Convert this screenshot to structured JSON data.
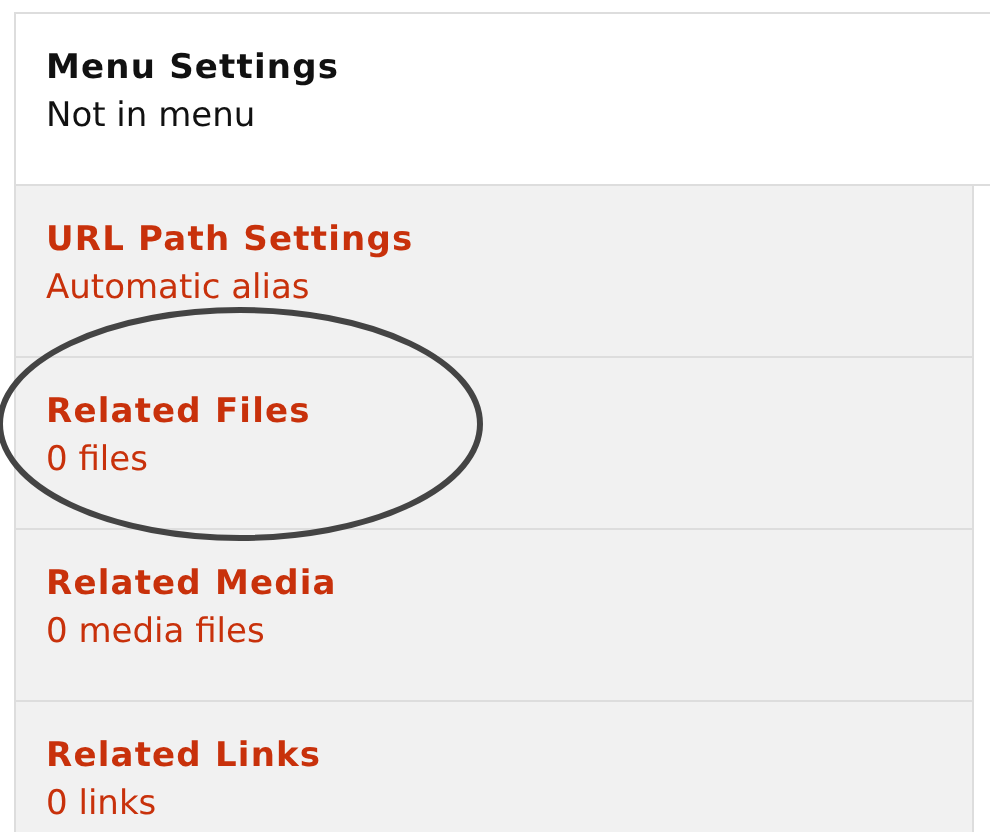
{
  "tabs": [
    {
      "title": "Menu Settings",
      "summary": "Not in menu",
      "selected": true
    },
    {
      "title": "URL Path Settings",
      "summary": "Automatic alias",
      "selected": false
    },
    {
      "title": "Related Files",
      "summary": "0 files",
      "selected": false
    },
    {
      "title": "Related Media",
      "summary": "0 media files",
      "selected": false
    },
    {
      "title": "Related Links",
      "summary": "0 links",
      "selected": false
    }
  ]
}
